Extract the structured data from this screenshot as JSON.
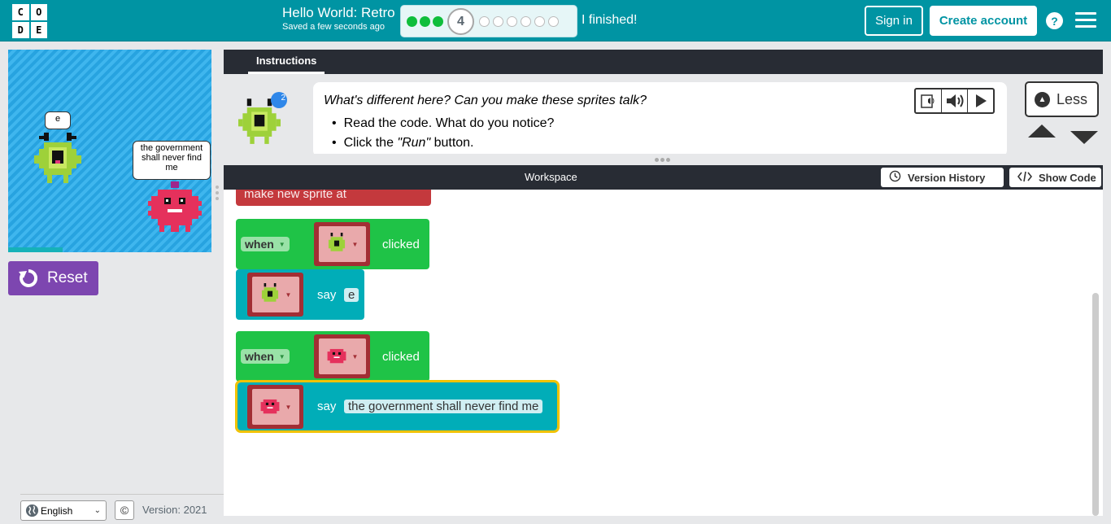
{
  "header": {
    "logo_letters": [
      "C",
      "O",
      "D",
      "E"
    ],
    "lesson_title": "Hello World: Retro",
    "saved_note": "Saved a few seconds ago",
    "current_level": "4",
    "levels_completed": 3,
    "levels_remaining": 6,
    "finished_label": "I finished!",
    "sign_in": "Sign in",
    "create_account": "Create account",
    "help": "?"
  },
  "stage": {
    "bubble_left": "e",
    "bubble_right": "the government shall never find me",
    "reset_label": "Reset"
  },
  "footer": {
    "language": "English",
    "copyright_icon": "©",
    "version": "Version: 2021"
  },
  "instructions": {
    "tab_label": "Instructions",
    "badge_count": "2",
    "question": "What's different here? Can you make these sprites talk?",
    "items": [
      "Read the code. What do you notice?"
    ],
    "run_item_prefix": "Click the ",
    "run_item_word": "\"Run\"",
    "run_item_suffix": " button.",
    "less_label": "Less"
  },
  "workspace": {
    "title": "Workspace",
    "version_history": "Version History",
    "show_code": "Show Code",
    "partial_block_text": "make new      sprite at",
    "blocks": [
      {
        "event_keyword": "when",
        "event_suffix": "clicked",
        "say_label": "say",
        "say_text": "e"
      },
      {
        "event_keyword": "when",
        "event_suffix": "clicked",
        "say_label": "say",
        "say_text": "the government shall never find me"
      }
    ]
  },
  "colors": {
    "header_bg": "#0094a3",
    "event_block": "#1fc347",
    "action_block": "#01adb8",
    "reset_button": "#7d46b0",
    "level_done": "#0fbe3b"
  },
  "icons": [
    "logo",
    "bell-icon",
    "read-aloud-icon",
    "speaker-icon",
    "play-icon",
    "chevron-up-icon",
    "arrow-up-icon",
    "arrow-down-icon",
    "clock-icon",
    "code-icon",
    "reset-icon",
    "globe-icon",
    "menu-icon",
    "help-icon"
  ]
}
